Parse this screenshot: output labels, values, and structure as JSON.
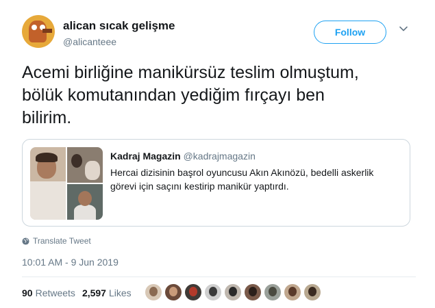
{
  "author": {
    "display_name": "alican sıcak gelişme",
    "username": "@alicanteee",
    "avatar_icon": "avatar-illustration"
  },
  "follow_label": "Follow",
  "tweet": {
    "lines": [
      "Acemi birliğine manikürsüz teslim olmuştum,",
      "bölük komutanından yediğim fırçayı ben",
      "bilirim."
    ]
  },
  "quote": {
    "display_name": "Kadraj Magazin",
    "username": "@kadrajmagazin",
    "lines": [
      "Hercai dizisinin başrol oyuncusu Akın Akınözü, bedelli askerlik",
      "görevi için saçını kestirip manikür yaptırdı."
    ]
  },
  "translate_label": "Translate Tweet",
  "timestamp": "10:01 AM - 9 Jun 2019",
  "stats": {
    "retweets_count": "90",
    "retweets_label": "Retweets",
    "likes_count": "2,597",
    "likes_label": "Likes"
  },
  "likers": [
    {
      "bg": "#d8c8b6",
      "fg": "#8a6a52"
    },
    {
      "bg": "#6b4a3a",
      "fg": "#c99b7a"
    },
    {
      "bg": "#3f3a36",
      "fg": "#b23a2a"
    },
    {
      "bg": "#cfcfcf",
      "fg": "#3a3a3a"
    },
    {
      "bg": "#bfb7ae",
      "fg": "#2a2a2a"
    },
    {
      "bg": "#7a5a4a",
      "fg": "#2b1f1a"
    },
    {
      "bg": "#9aa09a",
      "fg": "#4a4a40"
    },
    {
      "bg": "#c0a78e",
      "fg": "#5a3a2a"
    },
    {
      "bg": "#b8a890",
      "fg": "#3a2a20"
    }
  ],
  "colors": {
    "accent": "#1da1f2",
    "secondary_text": "#657786",
    "border": "#ccd6dd"
  }
}
